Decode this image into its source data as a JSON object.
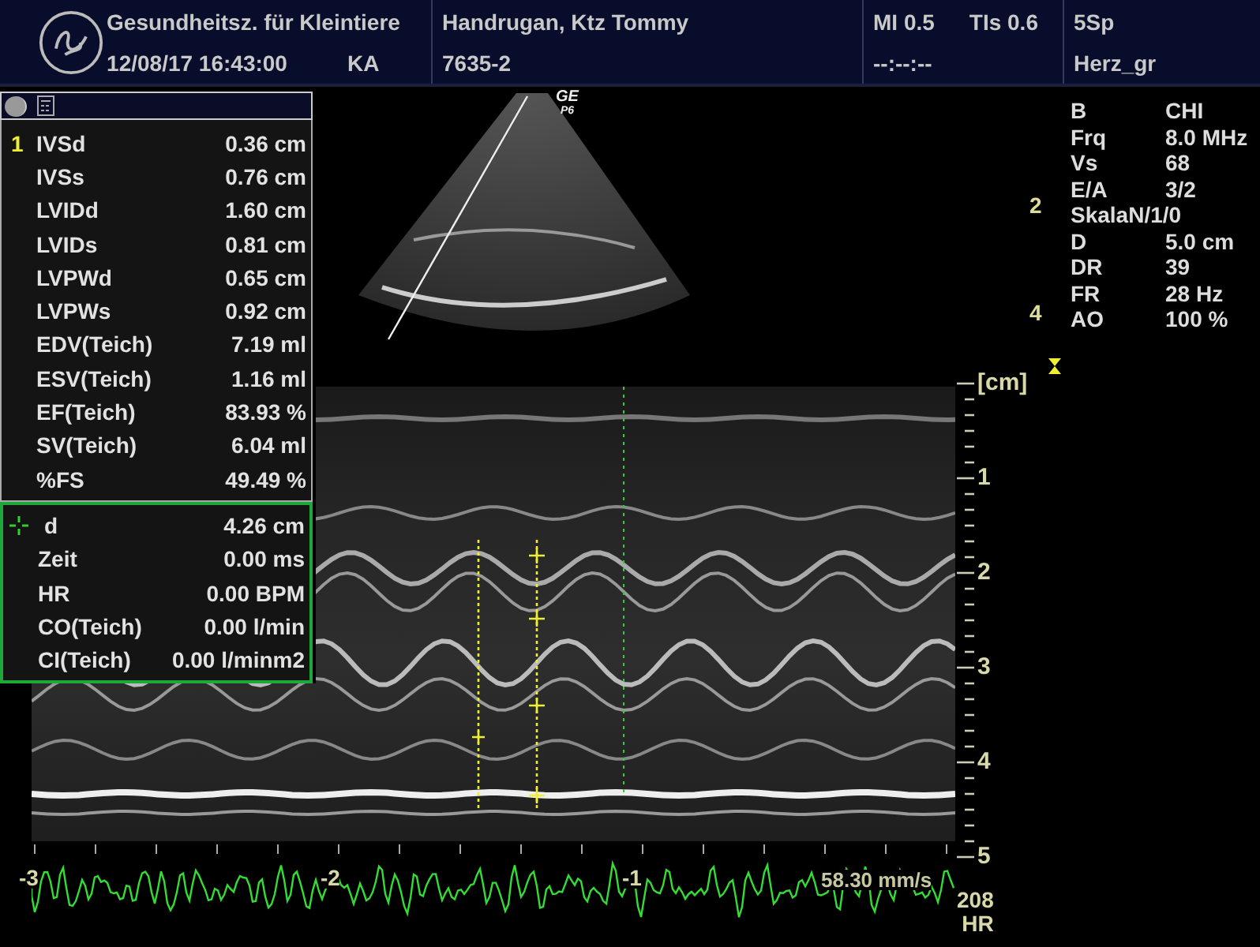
{
  "header": {
    "clinic": "Gesundheitsz. für Kleintiere",
    "datetime": "12/08/17 16:43:00",
    "operator": "KA",
    "patient_name": "Handrugan, Ktz Tommy",
    "patient_id": "7635-2",
    "mi": "MI 0.5",
    "tis": "TIs 0.6",
    "timer": "--:--:--",
    "probe": "5Sp",
    "preset": "Herz_gr"
  },
  "measurements": {
    "marker": "1",
    "rows": [
      {
        "label": "IVSd",
        "value": "0.36 cm"
      },
      {
        "label": "IVSs",
        "value": "0.76 cm"
      },
      {
        "label": "LVIDd",
        "value": "1.60 cm"
      },
      {
        "label": "LVIDs",
        "value": "0.81 cm"
      },
      {
        "label": "LVPWd",
        "value": "0.65 cm"
      },
      {
        "label": "LVPWs",
        "value": "0.92 cm"
      },
      {
        "label": "EDV(Teich)",
        "value": "7.19 ml"
      },
      {
        "label": "ESV(Teich)",
        "value": "1.16 ml"
      },
      {
        "label": "EF(Teich)",
        "value": "83.93 %"
      },
      {
        "label": "SV(Teich)",
        "value": "6.04 ml"
      },
      {
        "label": "%FS",
        "value": "49.49 %"
      }
    ]
  },
  "caliper_results": {
    "rows": [
      {
        "label": "d",
        "value": "4.26 cm"
      },
      {
        "label": "Zeit",
        "value": "0.00 ms"
      },
      {
        "label": "HR",
        "value": "0.00 BPM"
      },
      {
        "label": "CO(Teich)",
        "value": "0.00 l/min"
      },
      {
        "label": "CI(Teich)",
        "value": "0.00 l/minm2"
      }
    ]
  },
  "sector": {
    "logo": "GE",
    "probe": "P6"
  },
  "parameters": [
    {
      "name": "B",
      "value": "CHI"
    },
    {
      "name": "Frq",
      "value": "8.0 MHz"
    },
    {
      "name": "Vs",
      "value": "68"
    },
    {
      "name": "E/A",
      "value": "3/2"
    },
    {
      "name": "SkalaN/1/0"
    },
    {
      "name": "D",
      "value": "5.0 cm"
    },
    {
      "name": "DR",
      "value": "39"
    },
    {
      "name": "FR",
      "value": "28 Hz"
    },
    {
      "name": "AO",
      "value": "100 %"
    }
  ],
  "sector_depth_labels": [
    "2",
    "4"
  ],
  "depth_scale": {
    "unit": "[cm]",
    "labels": [
      "1",
      "2",
      "3",
      "4",
      "5"
    ]
  },
  "time_labels": [
    "-3",
    "-2",
    "-1"
  ],
  "sweep_speed": "58.30 mm/s",
  "heart_rate": {
    "value": "208",
    "unit": "HR"
  }
}
